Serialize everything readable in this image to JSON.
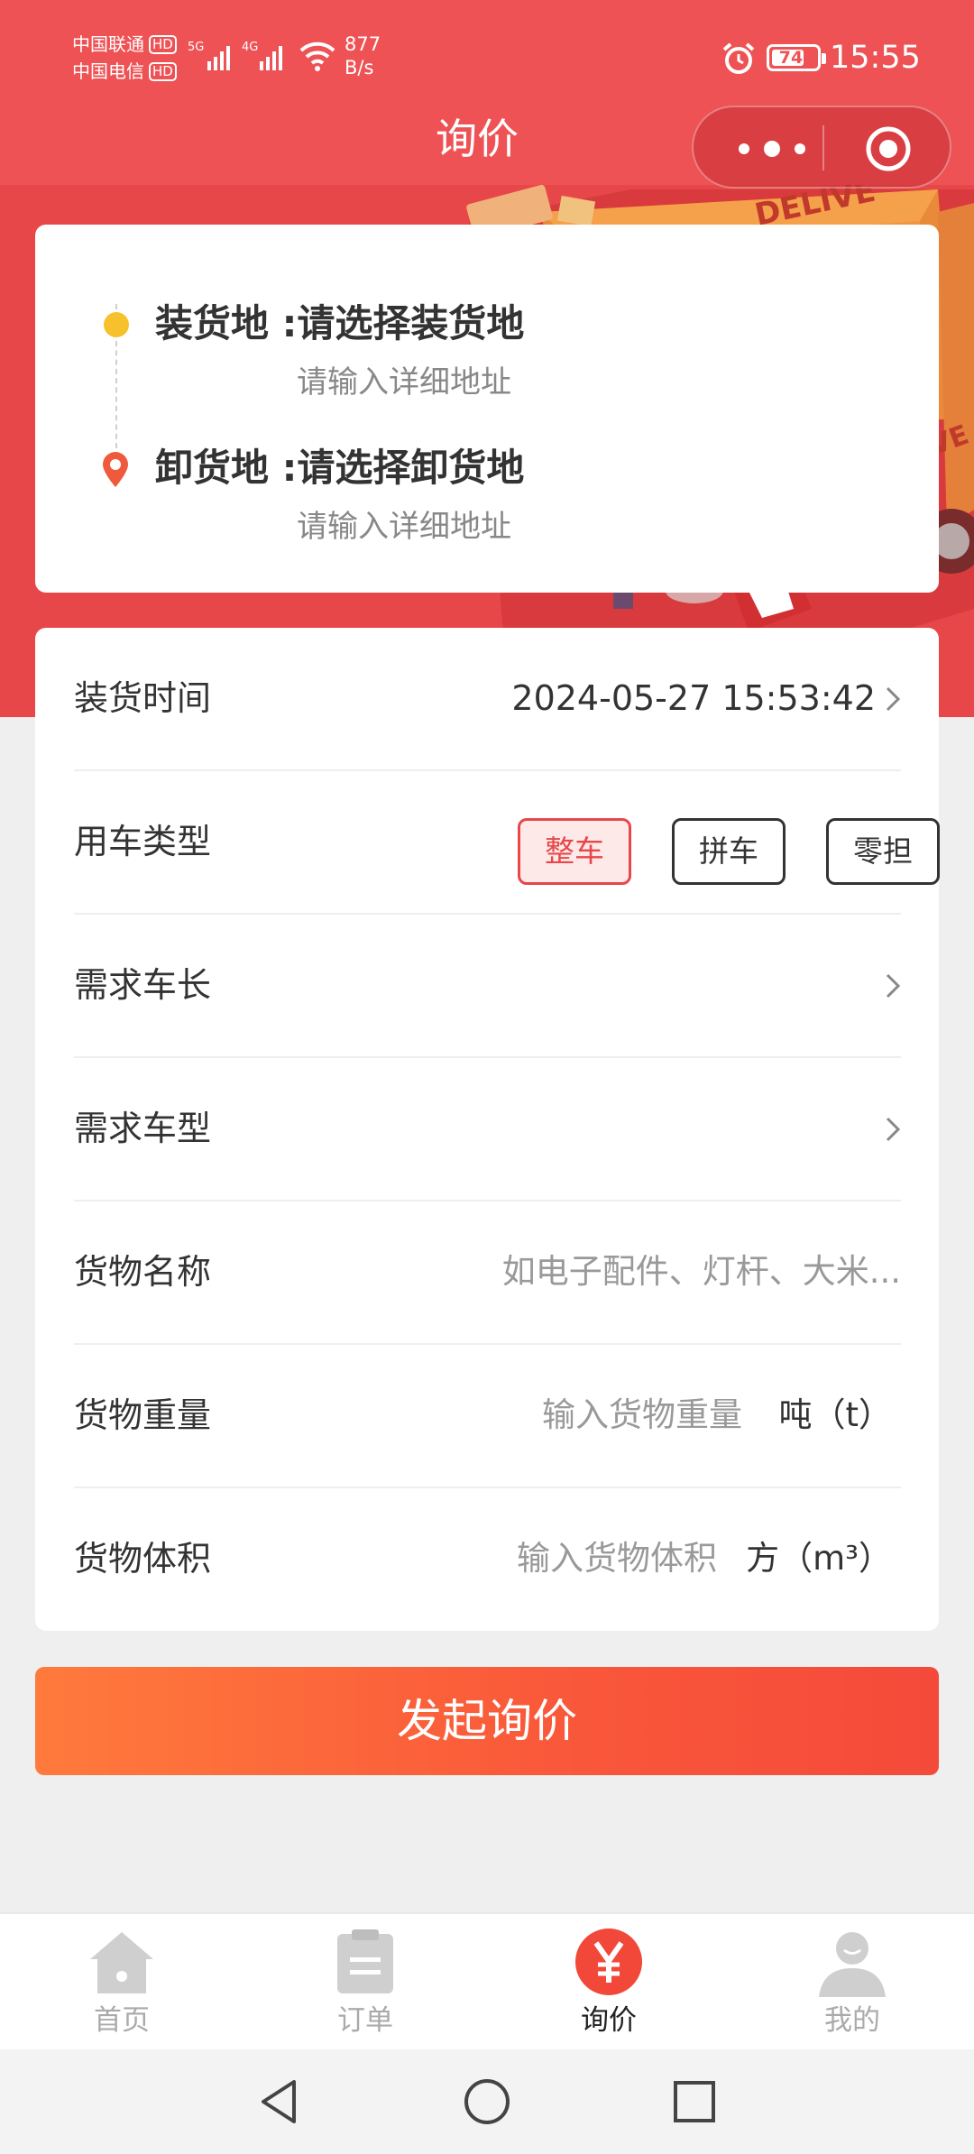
{
  "status_bar": {
    "carrier_1": "中国联通",
    "carrier_2": "中国电信",
    "hd_badge": "HD",
    "net_gen_1": "5G",
    "net_gen_2": "4G",
    "net_speed_value": "877",
    "net_speed_unit": "B/s",
    "battery": "74",
    "time": "15:55"
  },
  "nav": {
    "title": "询价"
  },
  "route": {
    "load_title": "装货地 :请选择装货地",
    "load_detail_placeholder": "请输入详细地址",
    "unload_title": "卸货地 :请选择卸货地",
    "unload_detail_placeholder": "请输入详细地址"
  },
  "form": {
    "load_time": {
      "label": "装货时间",
      "value": "2024-05-27 15:53:42"
    },
    "vehicle_type": {
      "label": "用车类型",
      "options": [
        "整车",
        "拼车",
        "零担"
      ],
      "selected": "整车"
    },
    "vehicle_length": {
      "label": "需求车长"
    },
    "vehicle_model": {
      "label": "需求车型"
    },
    "cargo_name": {
      "label": "货物名称",
      "placeholder": "如电子配件、灯杆、大米..."
    },
    "cargo_weight": {
      "label": "货物重量",
      "placeholder": "输入货物重量",
      "unit": "吨（t）"
    },
    "cargo_volume": {
      "label": "货物体积",
      "placeholder": "输入货物体积",
      "unit": "方（m³）"
    }
  },
  "submit_label": "发起询价",
  "tabbar": {
    "items": [
      {
        "label": "首页",
        "icon": "home-icon"
      },
      {
        "label": "订单",
        "icon": "clipboard-icon"
      },
      {
        "label": "询价",
        "icon": "yen-icon",
        "active": true
      },
      {
        "label": "我的",
        "icon": "user-icon"
      }
    ]
  },
  "colors": {
    "brand_red": "#ee5254",
    "accent_orange": "#ff7a3c",
    "load_dot": "#f7c12b"
  }
}
